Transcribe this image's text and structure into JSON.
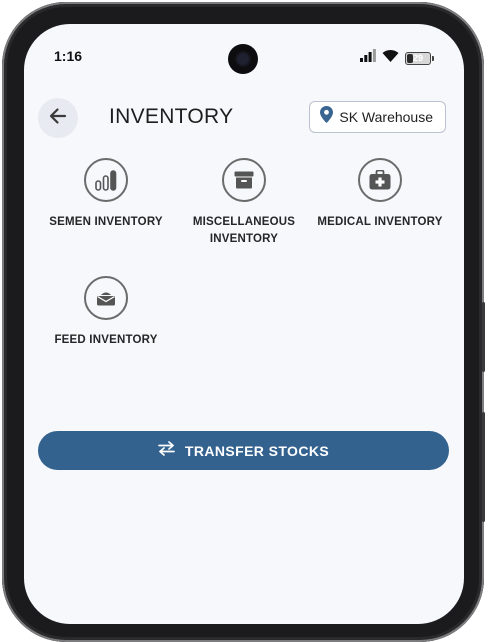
{
  "status_bar": {
    "time": "1:16",
    "battery_level": "29",
    "battery_fraction": 0.29,
    "icons": [
      "signal-icon",
      "wifi-icon",
      "battery-icon"
    ]
  },
  "header": {
    "back_icon": "arrow-left-icon",
    "title": "INVENTORY",
    "location_icon": "map-pin-icon",
    "location_label": "SK Warehouse"
  },
  "tiles": [
    {
      "label": "SEMEN INVENTORY",
      "icon": "bar-chart-icon"
    },
    {
      "label": "MISCELLANEOUS INVENTORY",
      "icon": "archive-box-icon"
    },
    {
      "label": "MEDICAL INVENTORY",
      "icon": "medical-kit-icon"
    },
    {
      "label": "FEED INVENTORY",
      "icon": "feed-tray-icon"
    }
  ],
  "transfer": {
    "icon": "swap-horizontal-icon",
    "label": "TRANSFER STOCKS"
  },
  "colors": {
    "primary": "#33628f",
    "screen_background": "#f6f8fc",
    "icon_gray": "#6b6b6b"
  }
}
